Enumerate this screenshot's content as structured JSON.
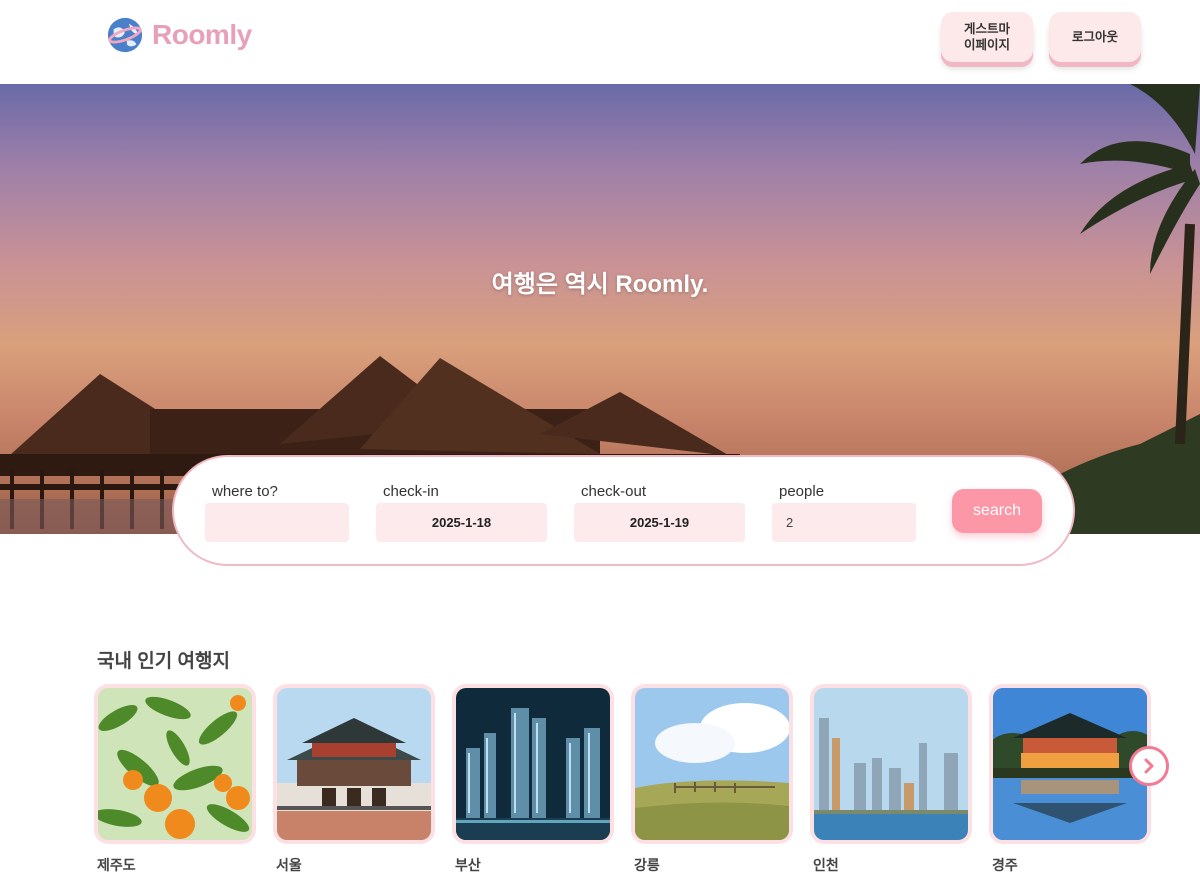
{
  "header": {
    "brand": "Roomly",
    "mypage_label_line1": "게스트마",
    "mypage_label_line2": "이페이지",
    "logout_label": "로그아웃"
  },
  "hero": {
    "title": "여행은 역시 Roomly."
  },
  "search": {
    "where_label": "where to?",
    "where_value": "",
    "checkin_label": "check-in",
    "checkin_value": "2025-1-18",
    "checkout_label": "check-out",
    "checkout_value": "2025-1-19",
    "people_label": "people",
    "people_value": "2",
    "button_label": "search"
  },
  "popular": {
    "title": "국내 인기 여행지",
    "destinations": [
      {
        "name": "제주도"
      },
      {
        "name": "서울"
      },
      {
        "name": "부산"
      },
      {
        "name": "강릉"
      },
      {
        "name": "인천"
      },
      {
        "name": "경주"
      }
    ]
  },
  "colors": {
    "accent": "#fb97a7",
    "brand": "#e8a0b8",
    "soft_pink": "#fdeaec"
  },
  "icons": {
    "logo": "globe-icon",
    "next": "chevron-right-icon"
  }
}
